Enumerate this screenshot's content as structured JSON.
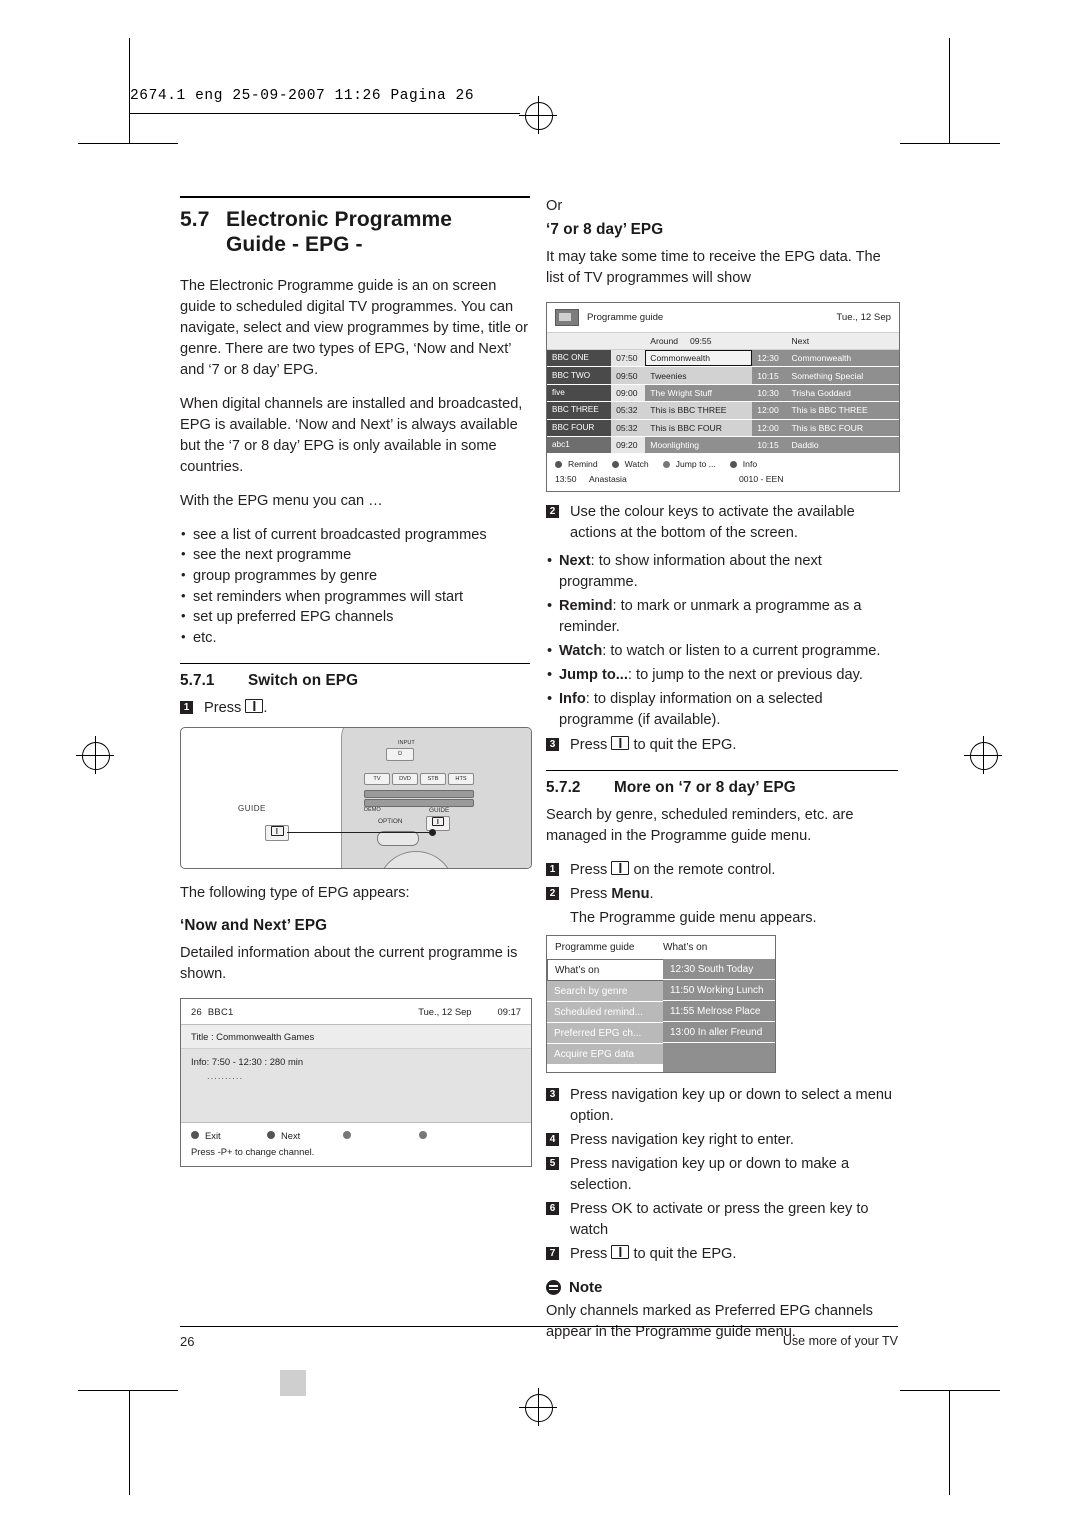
{
  "slug": {
    "text": "2674.1 eng  25-09-2007  11:26  Pagina 26"
  },
  "left": {
    "section_number": "5.7",
    "section_title_line1": "Electronic Programme",
    "section_title_line2": "Guide - EPG -",
    "para1": "The Electronic Programme guide is an on screen guide to scheduled digital TV programmes. You can navigate, select and view programmes by time, title or genre. There are two types of EPG, ‘Now and Next’ and ‘7 or 8 day’ EPG.",
    "para2": "When digital channels are installed and broadcasted, EPG is available. ‘Now and Next’ is always available but the ‘7 or 8 day’ EPG is only available in some countries.",
    "para3": "With the EPG menu you can …",
    "bullets": [
      "see a list of current broadcasted programmes",
      "see the next programme",
      "group programmes by genre",
      "set reminders when programmes will start",
      "set up preferred EPG channels",
      "etc."
    ],
    "sub1_number": "5.7.1",
    "sub1_title": "Switch on EPG",
    "step1": "Press",
    "step1_suffix": ".",
    "remote": {
      "input_label": "INPUT",
      "source_keys": [
        "TV",
        "DVD",
        "STB",
        "HTS"
      ],
      "demo_label": "DEMO",
      "guide_label": "GUIDE",
      "guide_right_label": "GUIDE",
      "option_label": "OPTION"
    },
    "after_remote": "The following type of EPG appears:",
    "nownext_title": "‘Now and Next’ EPG",
    "nownext_para": "Detailed information about the current programme is shown.",
    "tv_nownext": {
      "channel_number": "26",
      "channel_name": "BBC1",
      "date": "Tue., 12 Sep",
      "time": "09:17",
      "title_line": "Title : Commonwealth Games",
      "info_line": "Info: 7:50 - 12:30 : 280 min",
      "info_dots": "..........",
      "keys": [
        "Exit",
        "Next",
        "",
        ""
      ],
      "note": "Press -P+ to change channel."
    }
  },
  "right": {
    "or": "Or",
    "day_title": "‘7 or 8 day’ EPG",
    "day_para": "It may take some time to receive the EPG data. The list of TV programmes will show",
    "tv_epg": {
      "header_title": "Programme guide",
      "header_date": "Tue., 12 Sep",
      "col_headers": {
        "around": "Around",
        "around_time": "09:55",
        "next": "Next"
      },
      "rows": [
        {
          "channel": "BBC ONE",
          "t1": "07:50",
          "n1": "Commonwealth",
          "t2": "12:30",
          "n2": "Commonwealth",
          "selected": true
        },
        {
          "channel": "BBC TWO",
          "t1": "09:50",
          "n1": "Tweenies",
          "t2": "10:15",
          "n2": "Something Special",
          "selected": false
        },
        {
          "channel": "five",
          "t1": "09:00",
          "n1": "The Wright Stuff",
          "t2": "10:30",
          "n2": "Trisha Goddard",
          "selected": false
        },
        {
          "channel": "BBC THREE",
          "t1": "05:32",
          "n1": "This is BBC THREE",
          "t2": "12:00",
          "n2": "This is BBC THREE",
          "selected": false
        },
        {
          "channel": "BBC FOUR",
          "t1": "05:32",
          "n1": "This is BBC FOUR",
          "t2": "12:00",
          "n2": "This is BBC FOUR",
          "selected": false
        },
        {
          "channel": "abc1",
          "t1": "09:20",
          "n1": "Moonlighting",
          "t2": "10:15",
          "n2": "Daddio",
          "selected": false
        }
      ],
      "keys": [
        "Remind",
        "Watch",
        "Jump to ...",
        "Info"
      ],
      "footer_time": "13:50",
      "footer_name": "Anastasia",
      "footer_code": "0010 - EEN"
    },
    "step2": "Use the colour keys to activate the available actions at the bottom of the screen.",
    "colour_bullets": [
      {
        "key": "Next",
        "text": ": to show information about the next programme."
      },
      {
        "key": "Remind",
        "text": ": to mark or unmark a programme as a reminder."
      },
      {
        "key": "Watch",
        "text": ": to watch or listen to a current programme."
      },
      {
        "key": "Jump to...",
        "text": ": to jump to the next or previous day."
      },
      {
        "key": "Info",
        "text": ": to display information on a selected programme (if available)."
      }
    ],
    "step3_pre": "Press",
    "step3_post": "to quit the EPG.",
    "sub2_number": "5.7.2",
    "sub2_title": "More on ‘7 or 8 day’ EPG",
    "sub2_para": "Search by genre, scheduled reminders, etc. are managed in the Programme guide menu.",
    "m_step1_pre": "Press",
    "m_step1_post": "on the remote control.",
    "m_step2_pre": "Press",
    "m_step2_bold": "Menu",
    "m_step2_post": ".",
    "m_step2_sub": "The Programme guide menu appears.",
    "pg_menu": {
      "header_left": "Programme guide",
      "header_right": "What’s on",
      "left_items": [
        "What’s on",
        "Search by genre",
        "Scheduled remind...",
        "Preferred EPG ch...",
        "Acquire EPG data"
      ],
      "right_items": [
        "12:30 South Today",
        "11:50 Working Lunch",
        "11:55 Melrose Place",
        "13:00 In aller Freund"
      ]
    },
    "m_steps": [
      {
        "n": "3",
        "text": "Press navigation key up or down to select a menu option."
      },
      {
        "n": "4",
        "text": "Press navigation key right to enter."
      },
      {
        "n": "5",
        "text": "Press navigation key up or down to make a selection."
      },
      {
        "n": "6",
        "text": "Press OK to activate or press the green key to watch"
      }
    ],
    "m_step7_pre": "Press",
    "m_step7_post": "to quit the EPG.",
    "note_title": "Note",
    "note_text": "Only channels marked as Preferred EPG channels appear in the Programme guide menu."
  },
  "footer": {
    "page_number": "26",
    "right_text": "Use more of your TV"
  }
}
